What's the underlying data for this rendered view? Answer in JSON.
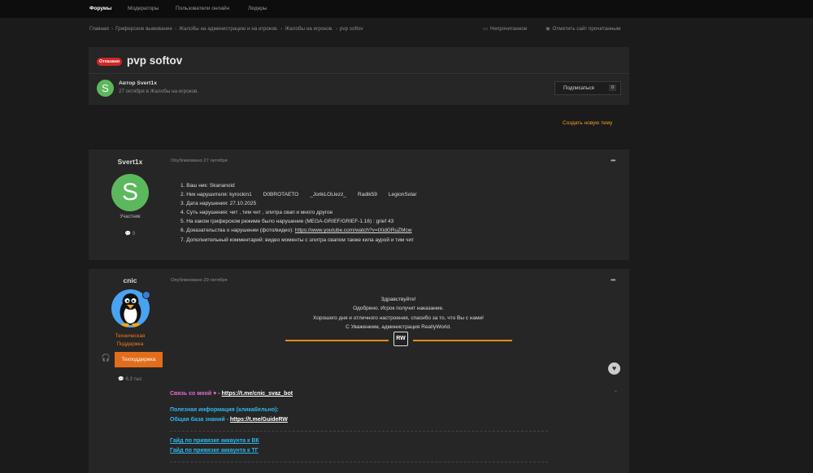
{
  "topnav": [
    "Форумы",
    "Модераторы",
    "Пользователи онлайн",
    "Лидеры"
  ],
  "breadcrumbs": [
    "Главная",
    "Гриферское выживание",
    "Жалобы на администрацию и на игроков.",
    "Жалобы на игроков.",
    "pvp softov"
  ],
  "actions": {
    "unread": "Непрочитанное",
    "mark_read": "Отметить сайт прочитанным"
  },
  "topic": {
    "badge": "Отказано",
    "title": "pvp softov",
    "author_label": "Автор Svert1x",
    "author_sub": "27 октября в Жалобы на игроков.",
    "subscribe_label": "Подписаться",
    "subscribe_count": "0",
    "create_new": "Создать новую тему"
  },
  "post1": {
    "author": "Svert1x",
    "avatar_letter": "S",
    "role": "Участник",
    "post_count": "9",
    "published": "Опубликовано 27 октября",
    "lines": [
      "1. Ваш ник: Skananoid",
      "2. Ник нарушителя: kyrockin1",
      "3. Дата нарушения: 27.10.2025",
      "4. Суть нарушения: чит , тим чит , элитра свап и много другое",
      "5. На каком гриферском режиме было нарушение (MEGA-GRIEF/GRIEF-1.16) : grief 43",
      "6. Доказательства о нарушении (фото/видео): ",
      "7. Дополнительный комментарий: видео моменты с элитра свапом также кила аурой и тим чит"
    ],
    "violators_extra": [
      "D0BROTAETO",
      "_JorikLOLlezz_",
      "Radik59",
      "LegionSolar"
    ],
    "link": "https://www.youtube.com/watch?v=tXidGRuZMcw"
  },
  "post2": {
    "author": "cnic",
    "role_line1": "Техническая",
    "role_line2": "Поддержка",
    "badge": "Техподдержка",
    "post_count": "6,3 тыс",
    "published": "Опубликовано 29 октября",
    "greeting": "Здравствуйте!",
    "body": [
      "Одобрено. Игрок получит наказание.",
      "Хорошего дня и отличного настроения, спасибо за то, что Вы с нами!",
      "С Уважением, администрация ReallyWorld."
    ],
    "logo": "RW",
    "sig": {
      "contact_label": "Связь со мной",
      "contact_dash": " - ",
      "contact_link": "https://t.me/cnic_svaz_bot",
      "info_title": "Полезная информация (кликабельно):",
      "kb_label": "Общая база знаний - ",
      "kb_link": "https://t.me/GuideRW",
      "guide_vk": "Гайд по привязке аккаунта к ВК",
      "guide_tg": "Гайд по привязке аккаунта к ТГ"
    }
  },
  "colors": {
    "accent": "#f59b23",
    "rejected": "#d02727",
    "avatar": "#5cb85c",
    "support": "#e36d1a"
  }
}
